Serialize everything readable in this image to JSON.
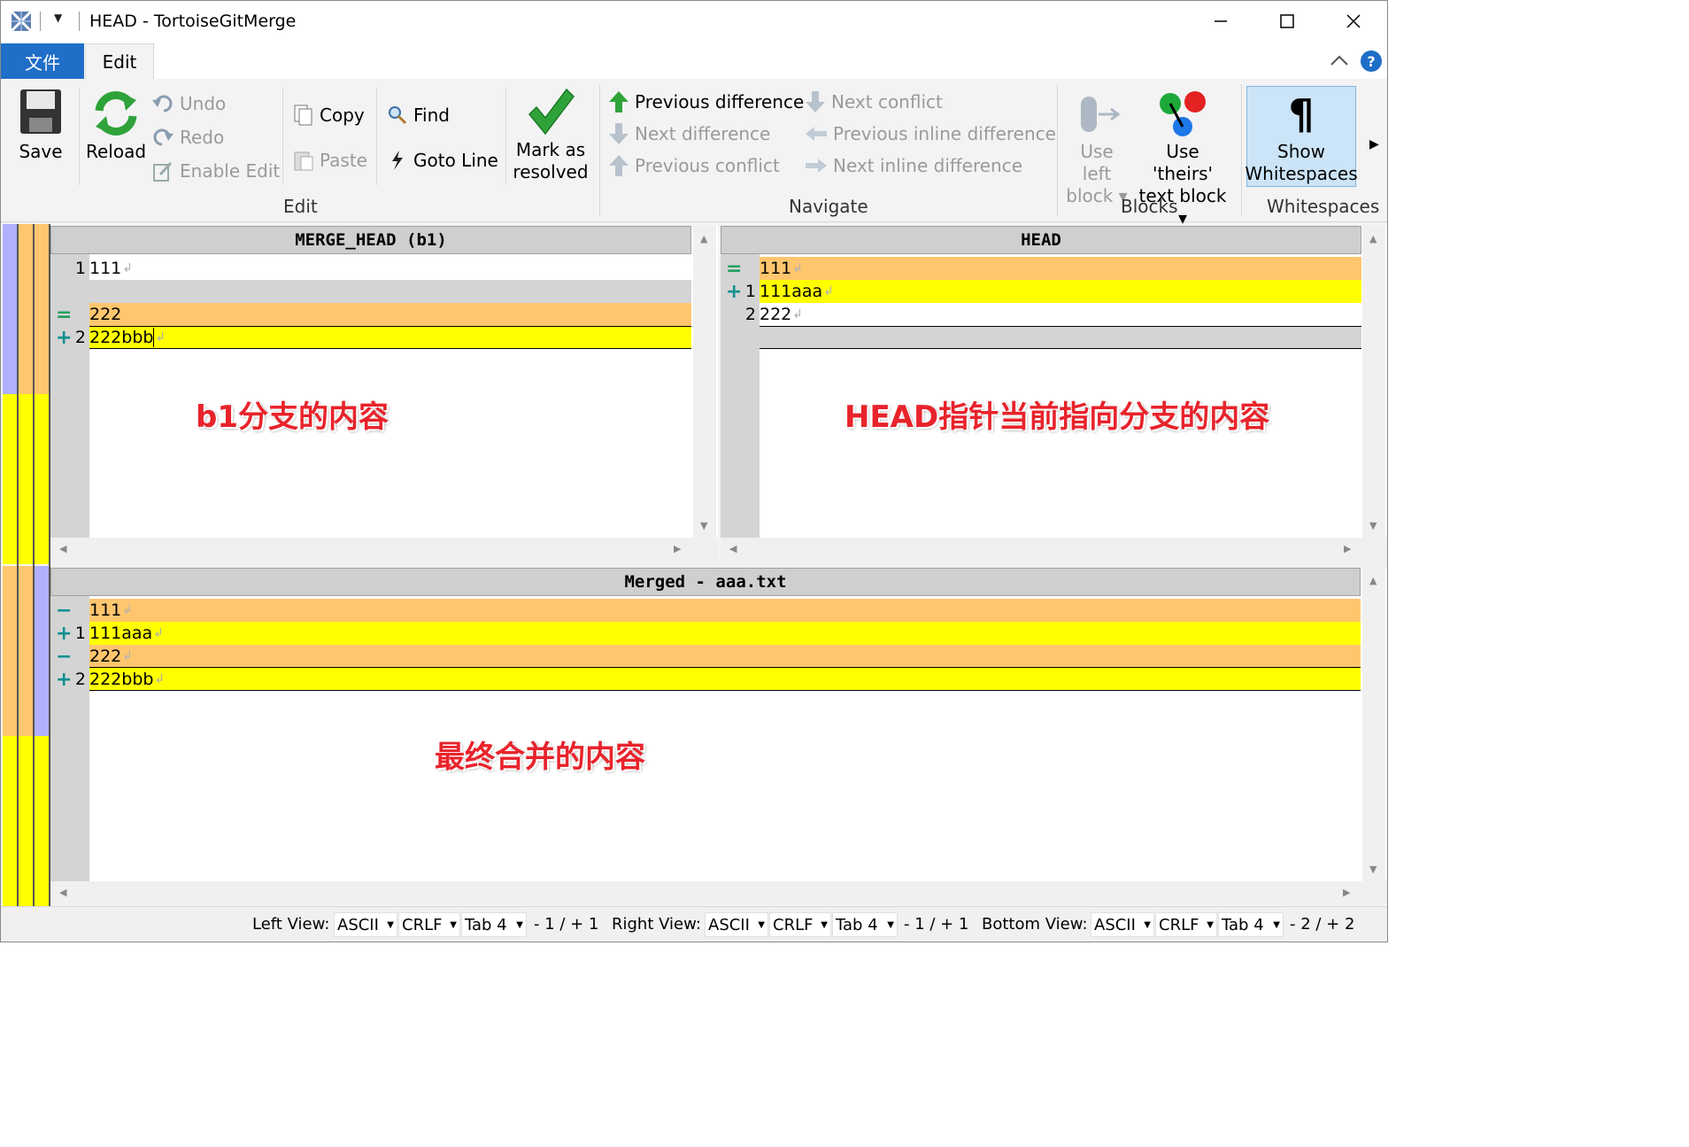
{
  "window": {
    "title": "HEAD - TortoiseGitMerge"
  },
  "tabs": {
    "file": "文件",
    "edit": "Edit"
  },
  "ribbon": {
    "save": "Save",
    "reload": "Reload",
    "undo": "Undo",
    "redo": "Redo",
    "enable_edit": "Enable Edit",
    "copy": "Copy",
    "paste": "Paste",
    "find": "Find",
    "goto_line": "Goto Line",
    "mark_resolved_1": "Mark as",
    "mark_resolved_2": "resolved",
    "prev_diff": "Previous difference",
    "next_diff": "Next difference",
    "prev_conflict": "Previous conflict",
    "next_conflict": "Next conflict",
    "prev_inline": "Previous inline difference",
    "next_inline": "Next inline difference",
    "use_left_1": "Use left",
    "use_left_2": "block",
    "use_theirs_1": "Use 'theirs'",
    "use_theirs_2": "text block",
    "show_ws_1": "Show",
    "show_ws_2": "Whitespaces",
    "groups": {
      "edit": "Edit",
      "navigate": "Navigate",
      "blocks": "Blocks",
      "whitespaces": "Whitespaces"
    }
  },
  "left_pane": {
    "header": "MERGE_HEAD (b1)",
    "lines": [
      {
        "marker": "",
        "num": "1",
        "text": "111"
      },
      {
        "marker": "",
        "num": "",
        "text": ""
      },
      {
        "marker": "=",
        "num": "",
        "text": "222"
      },
      {
        "marker": "+",
        "num": "2",
        "text": "222bbb"
      }
    ],
    "annotation": "b1分支的内容"
  },
  "right_pane": {
    "header": "HEAD",
    "lines": [
      {
        "marker": "=",
        "num": "",
        "text": "111"
      },
      {
        "marker": "+",
        "num": "1",
        "text": "111aaa"
      },
      {
        "marker": "",
        "num": "2",
        "text": "222"
      },
      {
        "marker": "",
        "num": "",
        "text": ""
      }
    ],
    "annotation": "HEAD指针当前指向分支的内容"
  },
  "bottom_pane": {
    "header": "Merged - aaa.txt",
    "lines": [
      {
        "marker": "−",
        "num": "",
        "text": "111"
      },
      {
        "marker": "+",
        "num": "1",
        "text": "111aaa"
      },
      {
        "marker": "−",
        "num": "",
        "text": "222"
      },
      {
        "marker": "+",
        "num": "2",
        "text": "222bbb"
      }
    ],
    "annotation": "最终合并的内容"
  },
  "status": {
    "left_view": "Left View:",
    "right_view": "Right View:",
    "bottom_view": "Bottom View:",
    "encoding": "ASCII",
    "eol": "CRLF",
    "tab": "Tab 4",
    "left_count": "- 1 / + 1",
    "right_count": "- 1 / + 1",
    "bottom_count": "- 2 / + 2"
  },
  "colors": {
    "conflict": "#ffc66e",
    "added": "#ffff00",
    "gutter": "#d4d4d4",
    "accent": "#1f6ec7"
  }
}
